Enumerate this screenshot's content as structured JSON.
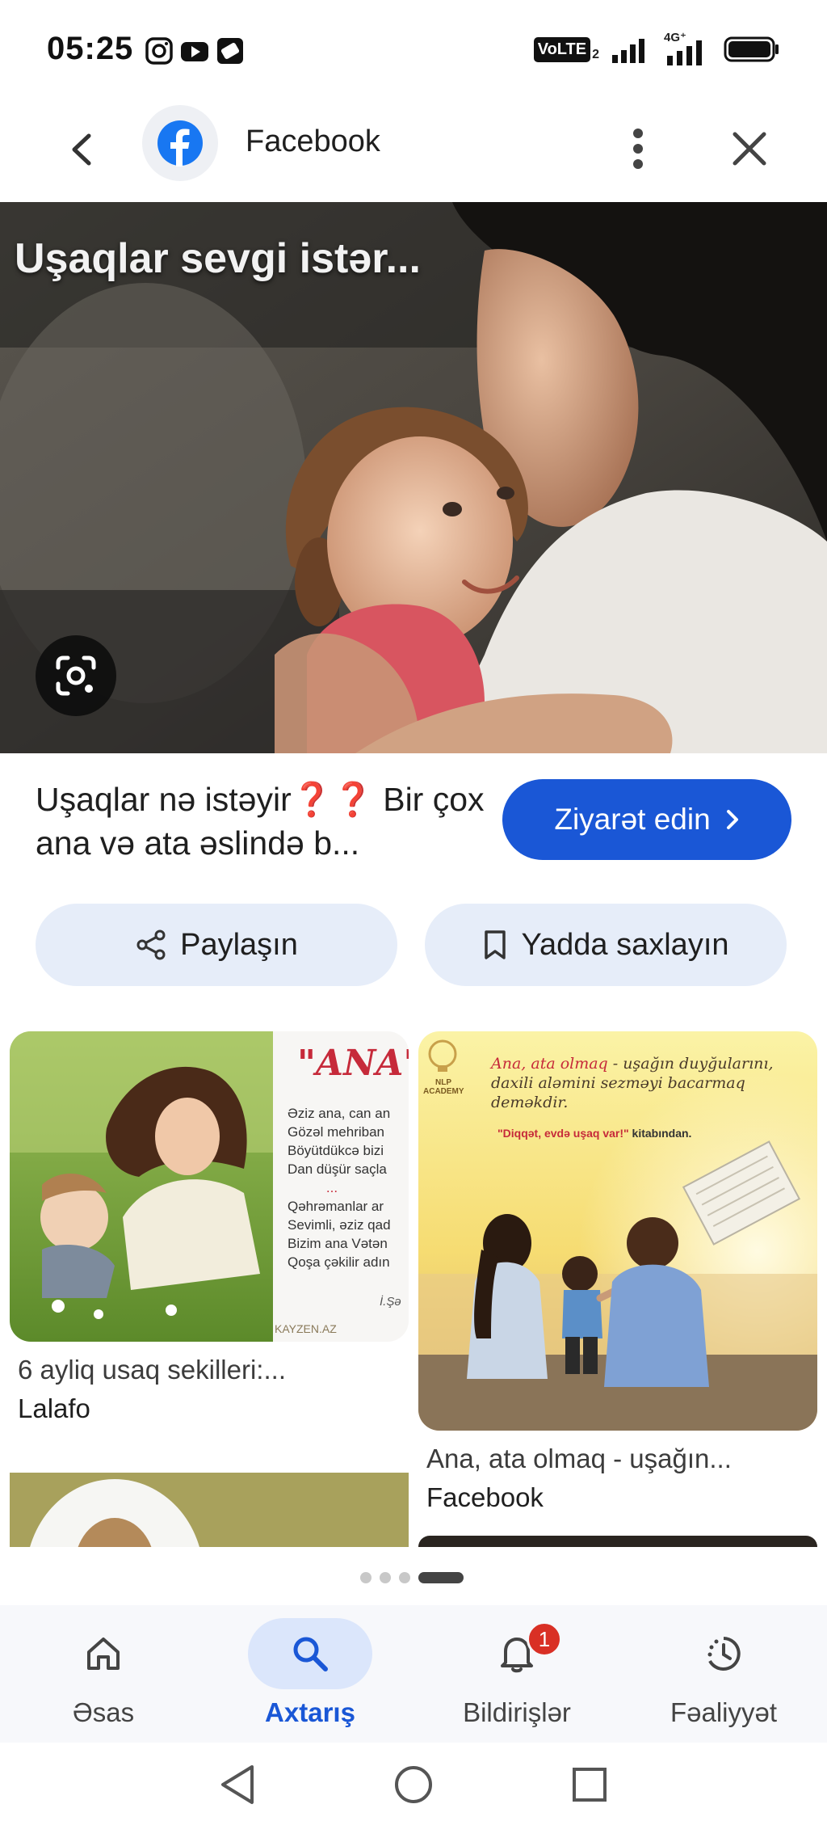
{
  "status_bar": {
    "time": "05:25",
    "left_icons": [
      "instagram-icon",
      "youtube-icon",
      "app-notification-icon"
    ],
    "right_indicators": [
      "VoLTE2",
      "signal-bars",
      "4G+",
      "signal-bars",
      "battery"
    ],
    "volte_label": "VoLTE",
    "volte_sub": "2",
    "network_label": "4G⁺"
  },
  "header": {
    "site_name": "Facebook",
    "site_icon": "facebook-icon"
  },
  "hero": {
    "caption": "Uşaqlar sevgi istər..."
  },
  "result": {
    "title": "Uşaqlar nə istəyir❓❓ Bir çox ana və ata əslində b...",
    "visit_label": "Ziyarət edin",
    "share_label": "Paylaşın",
    "save_label": "Yadda saxlayın"
  },
  "related": [
    {
      "caption": "6 ayliq usaq sekilleri:...",
      "source": "Lalafo",
      "poem_title": "\"ANA\"",
      "poem_lines": [
        "Əziz ana, can an",
        "Gözəl mehriban",
        "Böyütdükcə bizi",
        "Dan düşür saçla",
        "...",
        "Qəhrəmanlar ar",
        "Sevimli, əziz qad",
        "Bizim ana Vətən",
        "Qoşa çəkilir adın"
      ],
      "watermark": "KAYZEN.AZ",
      "signature": "İ.Şə"
    },
    {
      "caption": "Ana, ata olmaq - uşağın...",
      "source": "Facebook",
      "quote_lead": "Ana, ata olmaq",
      "quote_rest": " - uşağın duyğularını, daxili aləmini sezməyi bacarmaq deməkdir.",
      "book_ref": "\"Diqqət, evdə uşaq var!\"",
      "book_suffix": " kitabından.",
      "logo_text": "NLP ACADEMY"
    }
  ],
  "pagination": {
    "total": 4,
    "active": 4
  },
  "bottom_nav": [
    {
      "label": "Əsas",
      "icon": "home-icon",
      "active": false
    },
    {
      "label": "Axtarış",
      "icon": "search-icon",
      "active": true
    },
    {
      "label": "Bildirişlər",
      "icon": "bell-icon",
      "active": false,
      "badge": "1"
    },
    {
      "label": "Fəaliyyət",
      "icon": "activity-icon",
      "active": false
    }
  ],
  "colors": {
    "accent": "#1a57d6",
    "pill_bg": "#e6edf9",
    "badge": "#d93025"
  }
}
